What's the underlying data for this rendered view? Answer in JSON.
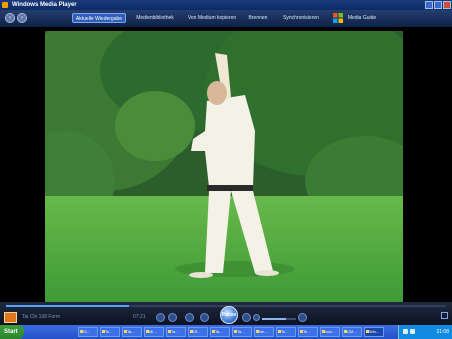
{
  "window": {
    "title": "Windows Media Player"
  },
  "nav": {
    "tabs": [
      {
        "label": "Aktuelle Wiedergabe",
        "active": true
      },
      {
        "label": "Medienbibliothek"
      },
      {
        "label": "Von Medium kopieren"
      },
      {
        "label": "Brennen"
      },
      {
        "label": "Synchronisieren"
      },
      {
        "label": "Media Guide"
      }
    ]
  },
  "player": {
    "now_playing_text": "Tai Chi 108 Form",
    "time": "07:21",
    "play_label": "Pause",
    "seek_progress": 0.28,
    "volume_level": 0.7
  },
  "taskbar": {
    "start_label": "Start",
    "items": [
      {
        "label": "Gi..."
      },
      {
        "label": "Te..."
      },
      {
        "label": "Ta..."
      },
      {
        "label": "Mi..."
      },
      {
        "label": "Ta..."
      },
      {
        "label": "Of..."
      },
      {
        "label": "Ta..."
      },
      {
        "label": "Ta..."
      },
      {
        "label": "Ne..."
      },
      {
        "label": "Te..."
      },
      {
        "label": "Te..."
      },
      {
        "label": "cod..."
      },
      {
        "label": "CM..."
      },
      {
        "label": "Win...",
        "active": true
      }
    ],
    "clock": "21:08"
  },
  "colors": {
    "accent": "#2f5db8",
    "grass": "#5db440",
    "foliage": "#2f6b2f"
  }
}
